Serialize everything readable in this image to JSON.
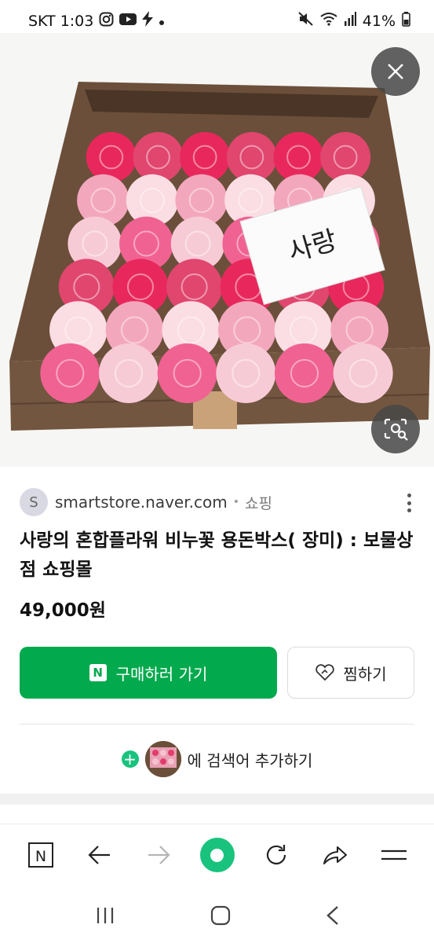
{
  "status_bar": {
    "time": "SKT 1:03",
    "battery": "41%"
  },
  "hero": {
    "card_text": "사랑"
  },
  "source": {
    "avatar_letter": "S",
    "domain": "smartstore.naver.com",
    "separator": "•",
    "category": "쇼핑"
  },
  "product": {
    "title": "사랑의 혼합플라워 비누꽃 용돈박스( 장미) : 보물상점 쇼핑몰",
    "price": "49,000원"
  },
  "buttons": {
    "buy_logo": "N",
    "buy_label": "구매하러 가기",
    "wish_label": "찜하기"
  },
  "add_search": {
    "plus": "+",
    "label": "에 검색어 추가하기"
  },
  "toolbar": {
    "home_logo": "N"
  },
  "colors": {
    "accent_green": "#03a94d",
    "dot_green": "#19c37d"
  }
}
